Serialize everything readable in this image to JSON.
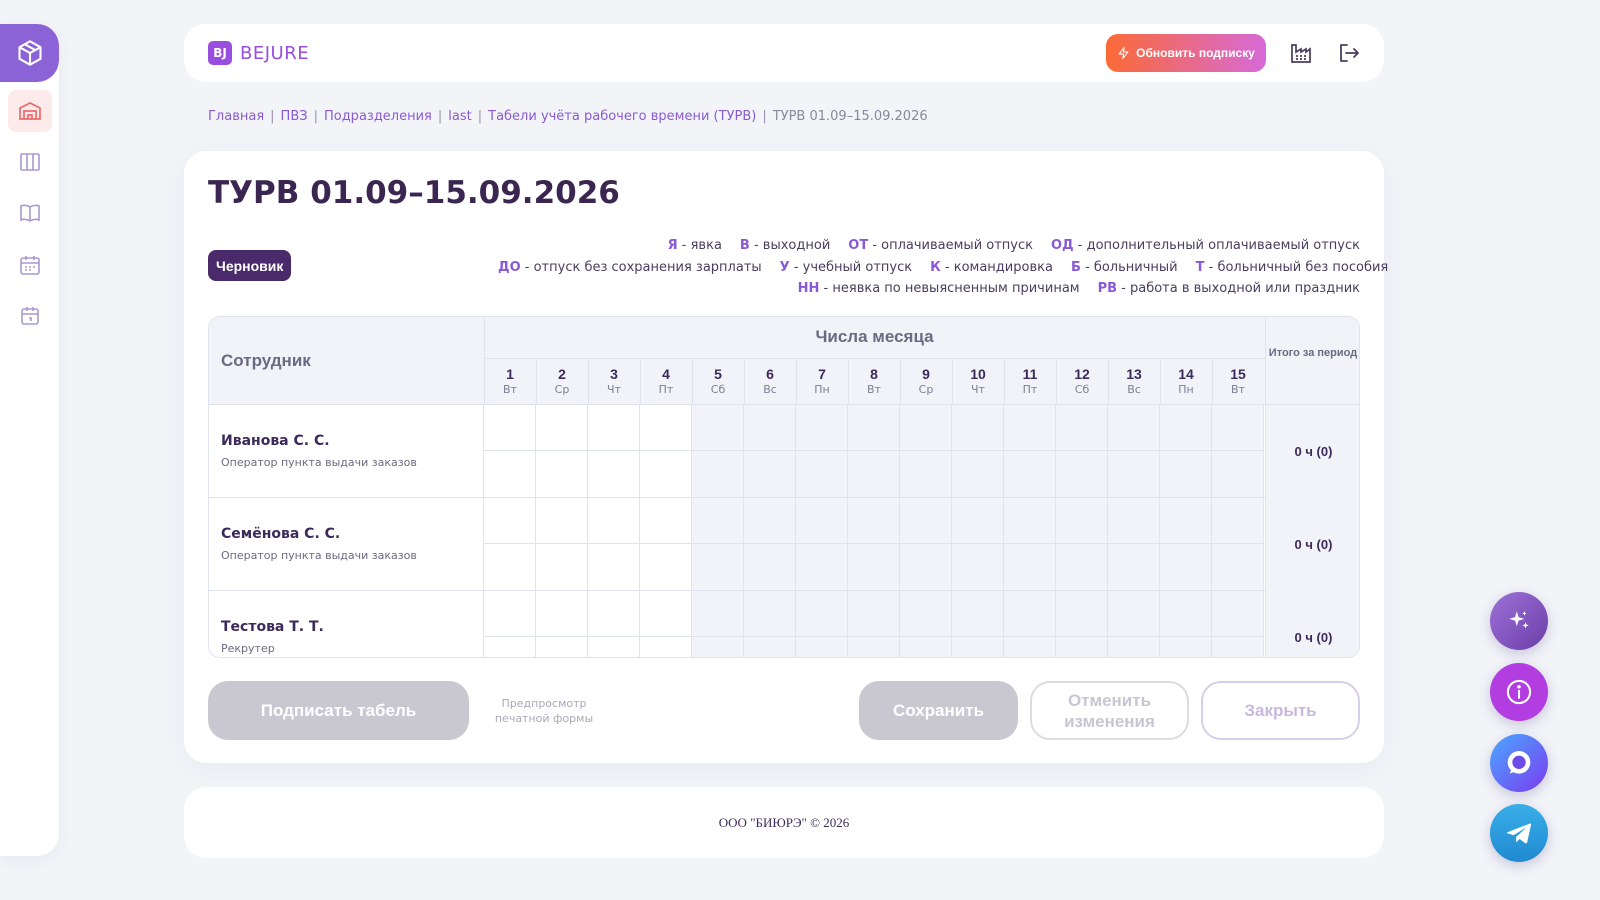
{
  "brand": {
    "mark": "BJ",
    "name": "BEJURE"
  },
  "header": {
    "upgrade_label": "Обновить подписку"
  },
  "breadcrumb": [
    "Главная",
    "ПВЗ",
    "Подразделения",
    "last",
    "Табели учёта рабочего времени (ТУРВ)",
    "ТУРВ 01.09–15.09.2026"
  ],
  "page": {
    "title": "ТУРВ 01.09–15.09.2026",
    "status": "Черновик"
  },
  "legend": [
    [
      {
        "code": "Я",
        "text": " - явка"
      },
      {
        "code": "В",
        "text": " - выходной"
      },
      {
        "code": "ОТ",
        "text": " - оплачиваемый отпуск"
      },
      {
        "code": "ОД",
        "text": " - дополнительный оплачиваемый отпуск"
      }
    ],
    [
      {
        "code": "ДО",
        "text": " - отпуск без сохранения зарплаты"
      },
      {
        "code": "У",
        "text": " - учебный отпуск"
      },
      {
        "code": "К",
        "text": " - командировка"
      },
      {
        "code": "Б",
        "text": " - больничный"
      },
      {
        "code": "Т",
        "text": " - больничный без пособия"
      }
    ],
    [
      {
        "code": "НН",
        "text": " - неявка по невыясненным причинам"
      },
      {
        "code": "РВ",
        "text": " - работа в выходной или праздник"
      }
    ]
  ],
  "table": {
    "employee_header": "Сотрудник",
    "days_header": "Числа месяца",
    "total_header": "Итого за период",
    "days": [
      {
        "num": "1",
        "wd": "Вт"
      },
      {
        "num": "2",
        "wd": "Ср"
      },
      {
        "num": "3",
        "wd": "Чт"
      },
      {
        "num": "4",
        "wd": "Пт"
      },
      {
        "num": "5",
        "wd": "Сб"
      },
      {
        "num": "6",
        "wd": "Вс"
      },
      {
        "num": "7",
        "wd": "Пн"
      },
      {
        "num": "8",
        "wd": "Вт"
      },
      {
        "num": "9",
        "wd": "Ср"
      },
      {
        "num": "10",
        "wd": "Чт"
      },
      {
        "num": "11",
        "wd": "Пт"
      },
      {
        "num": "12",
        "wd": "Сб"
      },
      {
        "num": "13",
        "wd": "Вс"
      },
      {
        "num": "14",
        "wd": "Пн"
      },
      {
        "num": "15",
        "wd": "Вт"
      }
    ],
    "rows": [
      {
        "name": "Иванова С. С.",
        "role": "Оператор пункта выдачи заказов",
        "total": "0 ч (0)"
      },
      {
        "name": "Семёнова С. С.",
        "role": "Оператор пункта выдачи заказов",
        "total": "0 ч (0)"
      },
      {
        "name": "Тестова Т. Т.",
        "role": "Рекрутер",
        "total": "0 ч (0)"
      }
    ]
  },
  "actions": {
    "sign": "Подписать табель",
    "preview": "Предпросмотр печатной формы",
    "save": "Сохранить",
    "cancel": "Отменить изменения",
    "close": "Закрыть"
  },
  "footer": {
    "copyright": "ООО \"БИЮРЭ\" © 2026"
  },
  "colors": {
    "accent": "#8c63d6",
    "brand": "#9a4ee0",
    "status_badge": "#4a2a6a",
    "upgrade_start": "#fb6a36",
    "upgrade_end": "#d66ad8"
  },
  "icons": {
    "sidebar": [
      "box-icon",
      "warehouse-icon",
      "columns-icon",
      "book-icon",
      "calendar-grid-icon",
      "calendar-icon"
    ],
    "header": [
      "lightning-icon",
      "factory-icon",
      "logout-icon"
    ],
    "floating": [
      "sparkle-icon",
      "info-icon",
      "chat-icon",
      "telegram-icon"
    ]
  }
}
